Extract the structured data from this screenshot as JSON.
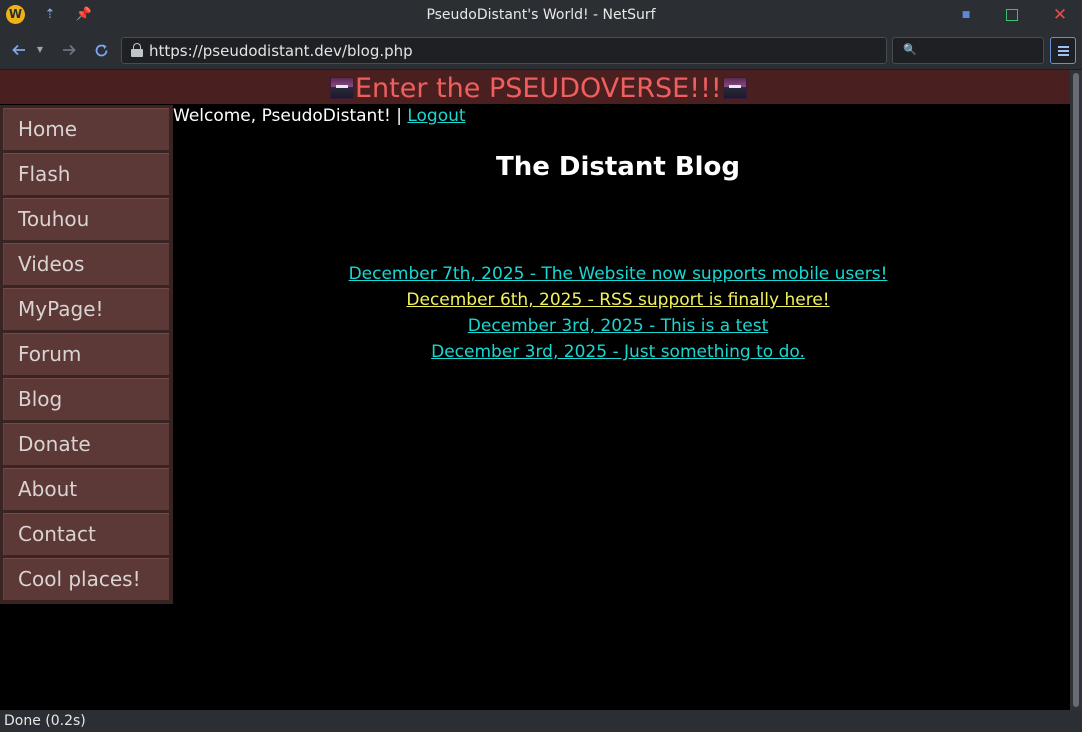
{
  "window": {
    "title": "PseudoDistant's World! - NetSurf",
    "app_icon_letter": "W"
  },
  "toolbar": {
    "url": "https://pseudodistant.dev/blog.php",
    "search_value": ""
  },
  "page": {
    "banner_text": "Enter the PSEUDOVERSE!!!",
    "sidebar": {
      "items": [
        {
          "label": "Home"
        },
        {
          "label": "Flash"
        },
        {
          "label": "Touhou"
        },
        {
          "label": "Videos"
        },
        {
          "label": "MyPage!"
        },
        {
          "label": "Forum"
        },
        {
          "label": "Blog"
        },
        {
          "label": "Donate"
        },
        {
          "label": "About"
        },
        {
          "label": "Contact"
        },
        {
          "label": "Cool places!"
        }
      ]
    },
    "welcome_text": "Welcome, PseudoDistant! |",
    "logout_label": "Logout",
    "blog_title": "The Distant Blog",
    "posts": [
      {
        "title": "December 7th, 2025 - The Website now supports mobile users!",
        "color": "#19d8d3"
      },
      {
        "title": "December 6th, 2025 - RSS support is finally here!",
        "color": "#f2f25c"
      },
      {
        "title": "December 3rd, 2025 - This is a test",
        "color": "#19d8d3"
      },
      {
        "title": "December 3rd, 2025 - Just something to do.",
        "color": "#19d8d3"
      }
    ]
  },
  "status": {
    "text": "Done (0.2s)"
  },
  "colors": {
    "banner_bg": "#4a1f1f",
    "banner_text": "#ef5f5f",
    "sidebar_item_bg": "#5c3836",
    "link": "#19d8d3",
    "highlight_link": "#f2f25c"
  }
}
